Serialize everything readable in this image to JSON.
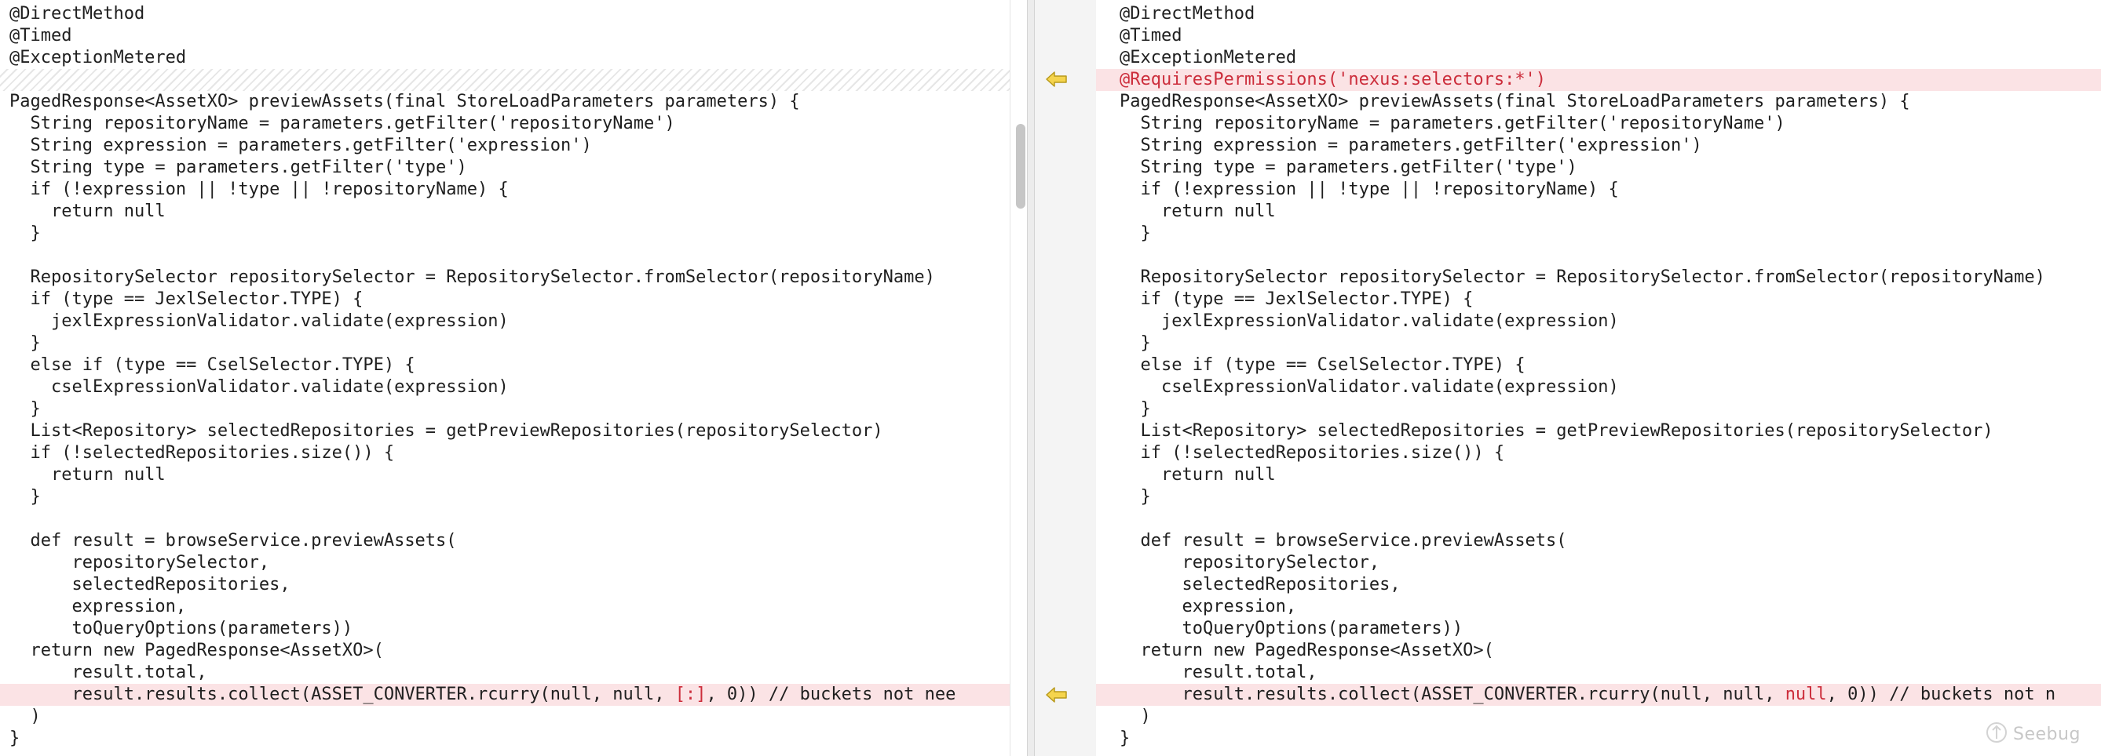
{
  "colors": {
    "changed_line_bg": "#fbe3e5",
    "changed_text": "#cc2d3b",
    "marker_arrow": "#f5d44d",
    "gutter_bg": "#f4f4f4"
  },
  "left_pane": {
    "lines": [
      {
        "segments": [
          "@DirectMethod"
        ]
      },
      {
        "segments": [
          "@Timed"
        ]
      },
      {
        "segments": [
          "@ExceptionMetered"
        ]
      },
      {
        "segments": [
          ""
        ],
        "placeholder": true
      },
      {
        "segments": [
          "PagedResponse<AssetXO> previewAssets(final StoreLoadParameters parameters) {"
        ]
      },
      {
        "segments": [
          "  String repositoryName = parameters.getFilter('repositoryName')"
        ]
      },
      {
        "segments": [
          "  String expression = parameters.getFilter('expression')"
        ]
      },
      {
        "segments": [
          "  String type = parameters.getFilter('type')"
        ]
      },
      {
        "segments": [
          "  if (!expression || !type || !repositoryName) {"
        ]
      },
      {
        "segments": [
          "    return null"
        ]
      },
      {
        "segments": [
          "  }"
        ]
      },
      {
        "segments": [
          ""
        ]
      },
      {
        "segments": [
          "  RepositorySelector repositorySelector = RepositorySelector.fromSelector(repositoryName)"
        ]
      },
      {
        "segments": [
          "  if (type == JexlSelector.TYPE) {"
        ]
      },
      {
        "segments": [
          "    jexlExpressionValidator.validate(expression)"
        ]
      },
      {
        "segments": [
          "  }"
        ]
      },
      {
        "segments": [
          "  else if (type == CselSelector.TYPE) {"
        ]
      },
      {
        "segments": [
          "    cselExpressionValidator.validate(expression)"
        ]
      },
      {
        "segments": [
          "  }"
        ]
      },
      {
        "segments": [
          "  List<Repository> selectedRepositories = getPreviewRepositories(repositorySelector)"
        ]
      },
      {
        "segments": [
          "  if (!selectedRepositories.size()) {"
        ]
      },
      {
        "segments": [
          "    return null"
        ]
      },
      {
        "segments": [
          "  }"
        ]
      },
      {
        "segments": [
          ""
        ]
      },
      {
        "segments": [
          "  def result = browseService.previewAssets("
        ]
      },
      {
        "segments": [
          "      repositorySelector,"
        ]
      },
      {
        "segments": [
          "      selectedRepositories,"
        ]
      },
      {
        "segments": [
          "      expression,"
        ]
      },
      {
        "segments": [
          "      toQueryOptions(parameters))"
        ]
      },
      {
        "segments": [
          "  return new PagedResponse<AssetXO>("
        ]
      },
      {
        "segments": [
          "      result.total,"
        ]
      },
      {
        "segments": [
          "      result.results.collect(ASSET_CONVERTER.rcurry(null, null, ",
          "[:]",
          ", 0)) // buckets not nee"
        ],
        "highlight_index": 1,
        "changed": true
      },
      {
        "segments": [
          "  )"
        ]
      },
      {
        "segments": [
          "}"
        ]
      }
    ]
  },
  "right_pane": {
    "lines": [
      {
        "segments": [
          "@DirectMethod"
        ]
      },
      {
        "segments": [
          "@Timed"
        ]
      },
      {
        "segments": [
          "@ExceptionMetered"
        ]
      },
      {
        "segments": [
          "@RequiresPermissions('nexus:selectors:*')"
        ],
        "highlight_index": 0,
        "changed": true
      },
      {
        "segments": [
          "PagedResponse<AssetXO> previewAssets(final StoreLoadParameters parameters) {"
        ]
      },
      {
        "segments": [
          "  String repositoryName = parameters.getFilter('repositoryName')"
        ]
      },
      {
        "segments": [
          "  String expression = parameters.getFilter('expression')"
        ]
      },
      {
        "segments": [
          "  String type = parameters.getFilter('type')"
        ]
      },
      {
        "segments": [
          "  if (!expression || !type || !repositoryName) {"
        ]
      },
      {
        "segments": [
          "    return null"
        ]
      },
      {
        "segments": [
          "  }"
        ]
      },
      {
        "segments": [
          ""
        ]
      },
      {
        "segments": [
          "  RepositorySelector repositorySelector = RepositorySelector.fromSelector(repositoryName)"
        ]
      },
      {
        "segments": [
          "  if (type == JexlSelector.TYPE) {"
        ]
      },
      {
        "segments": [
          "    jexlExpressionValidator.validate(expression)"
        ]
      },
      {
        "segments": [
          "  }"
        ]
      },
      {
        "segments": [
          "  else if (type == CselSelector.TYPE) {"
        ]
      },
      {
        "segments": [
          "    cselExpressionValidator.validate(expression)"
        ]
      },
      {
        "segments": [
          "  }"
        ]
      },
      {
        "segments": [
          "  List<Repository> selectedRepositories = getPreviewRepositories(repositorySelector)"
        ]
      },
      {
        "segments": [
          "  if (!selectedRepositories.size()) {"
        ]
      },
      {
        "segments": [
          "    return null"
        ]
      },
      {
        "segments": [
          "  }"
        ]
      },
      {
        "segments": [
          ""
        ]
      },
      {
        "segments": [
          "  def result = browseService.previewAssets("
        ]
      },
      {
        "segments": [
          "      repositorySelector,"
        ]
      },
      {
        "segments": [
          "      selectedRepositories,"
        ]
      },
      {
        "segments": [
          "      expression,"
        ]
      },
      {
        "segments": [
          "      toQueryOptions(parameters))"
        ]
      },
      {
        "segments": [
          "  return new PagedResponse<AssetXO>("
        ]
      },
      {
        "segments": [
          "      result.total,"
        ]
      },
      {
        "segments": [
          "      result.results.collect(ASSET_CONVERTER.rcurry(null, null, ",
          "null",
          ", 0)) // buckets not n"
        ],
        "highlight_index": 1,
        "changed": true
      },
      {
        "segments": [
          "  )"
        ]
      },
      {
        "segments": [
          "}"
        ]
      }
    ]
  },
  "gutter": {
    "markers": [
      {
        "icon": "arrow-left-icon",
        "line": 4
      },
      {
        "icon": "arrow-left-icon",
        "line": 32
      }
    ]
  },
  "watermark": {
    "text": "Seebug",
    "icon": "seebug-logo-icon"
  }
}
